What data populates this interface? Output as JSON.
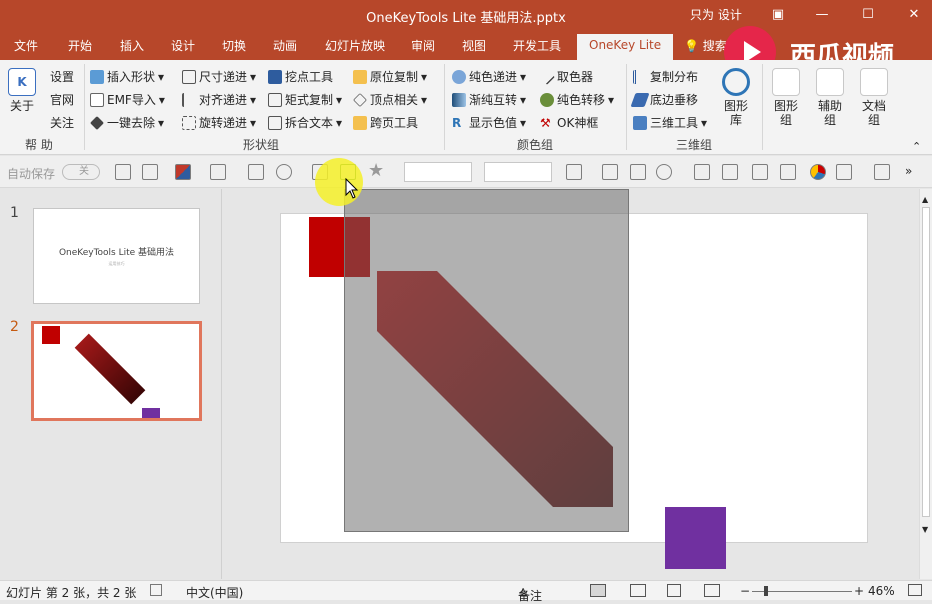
{
  "window": {
    "title": "OneKeyTools Lite 基础用法.pptx",
    "user": "只为 设计"
  },
  "tabs": [
    "文件",
    "开始",
    "插入",
    "设计",
    "切换",
    "动画",
    "幻灯片放映",
    "审阅",
    "视图",
    "开发工具",
    "OneKey Lite"
  ],
  "tell_me": "搜索",
  "watermark": "西瓜视频",
  "ribbon": {
    "help": {
      "about": "关于",
      "settings": "设置",
      "website": "官网",
      "follow": "关注",
      "group": "帮 助"
    },
    "shape": {
      "insert_shape": "插入形状",
      "emf_import": "EMF导入",
      "one_click_remove": "一键去除",
      "size_step": "尺寸递进",
      "align_step": "对齐递进",
      "rotate_step": "旋转递进",
      "cutout_tool": "挖点工具",
      "matrix_copy": "矩式复制",
      "split_text": "拆合文本",
      "inplace_copy": "原位复制",
      "vertex_related": "顶点相关",
      "page_tool": "跨页工具",
      "group": "形状组"
    },
    "color": {
      "pure_step": "纯色递进",
      "gradient_swap": "渐纯互转",
      "show_value": "显示色值",
      "picker": "取色器",
      "pure_transfer": "纯色转移",
      "ok_brush": "OK神框",
      "group": "颜色组"
    },
    "three_d": {
      "copy_dist": "复制分布",
      "edge_stack": "底边垂移",
      "tools_3d": "三维工具",
      "group": "三维组"
    },
    "big_buttons": {
      "shape_lib": "图形库",
      "shape_group": "图形组",
      "aux_group": "辅助组",
      "doc_group": "文档组"
    }
  },
  "qat": {
    "autosave": "自动保存",
    "autosave_state": "关"
  },
  "thumbnails": [
    {
      "number": "1",
      "title": "OneKeyTools Lite 基础用法",
      "subtitle": "运用技巧"
    },
    {
      "number": "2"
    }
  ],
  "status": {
    "slide_info": "幻灯片 第 2 张，共 2 张",
    "language": "中文(中国)",
    "notes": "备注",
    "zoom": "46%"
  },
  "colors": {
    "accent": "#b7472a",
    "red_square": "#c00000",
    "purple_square": "#7030a0",
    "gradient_dark": "#5a1a1a"
  }
}
